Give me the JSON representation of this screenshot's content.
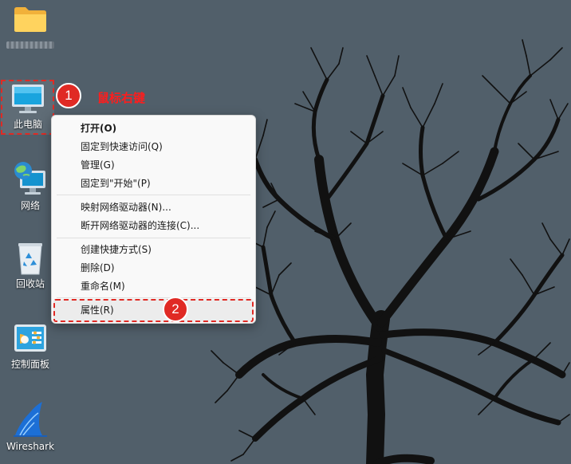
{
  "desktop": {
    "icons": [
      {
        "label": ""
      },
      {
        "label": "此电脑"
      },
      {
        "label": "网络"
      },
      {
        "label": "回收站"
      },
      {
        "label": "控制面板"
      },
      {
        "label": "Wireshark"
      }
    ]
  },
  "annotations": {
    "step1": "1",
    "step1_text": "鼠标右键",
    "step2": "2",
    "color": "#e02a24"
  },
  "context_menu": {
    "items": [
      {
        "label": "打开(O)"
      },
      {
        "label": "固定到快速访问(Q)"
      },
      {
        "label": "管理(G)"
      },
      {
        "label": "固定到\"开始\"(P)"
      },
      {
        "label": "映射网络驱动器(N)..."
      },
      {
        "label": "断开网络驱动器的连接(C)..."
      },
      {
        "label": "创建快捷方式(S)"
      },
      {
        "label": "删除(D)"
      },
      {
        "label": "重命名(M)"
      },
      {
        "label": "属性(R)"
      }
    ]
  },
  "colors": {
    "background": "#515f6a",
    "menu_background": "#f9f9f9",
    "tree": "#111111"
  }
}
